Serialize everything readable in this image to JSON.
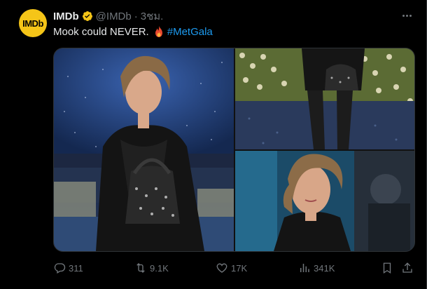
{
  "post": {
    "author_name": "IMDb",
    "avatar_text": "IMDb",
    "handle": "@IMDb",
    "separator": "·",
    "time": "3ชม.",
    "text": "Mook could NEVER.",
    "hashtag": "#MetGala",
    "verified_icon": "verified-badge-icon",
    "emoji_icon": "fire-emoji-icon"
  },
  "media": {
    "photos": [
      {
        "name": "photo-1"
      },
      {
        "name": "photo-2"
      },
      {
        "name": "photo-3"
      }
    ]
  },
  "actions": {
    "replies": "311",
    "reposts": "9.1K",
    "likes": "17K",
    "views": "341K"
  },
  "colors": {
    "background": "#000000",
    "text": "#e7e9ea",
    "muted": "#71767b",
    "link": "#1d9bf0",
    "verified": "#f5c518",
    "brand": "#f5c518"
  }
}
